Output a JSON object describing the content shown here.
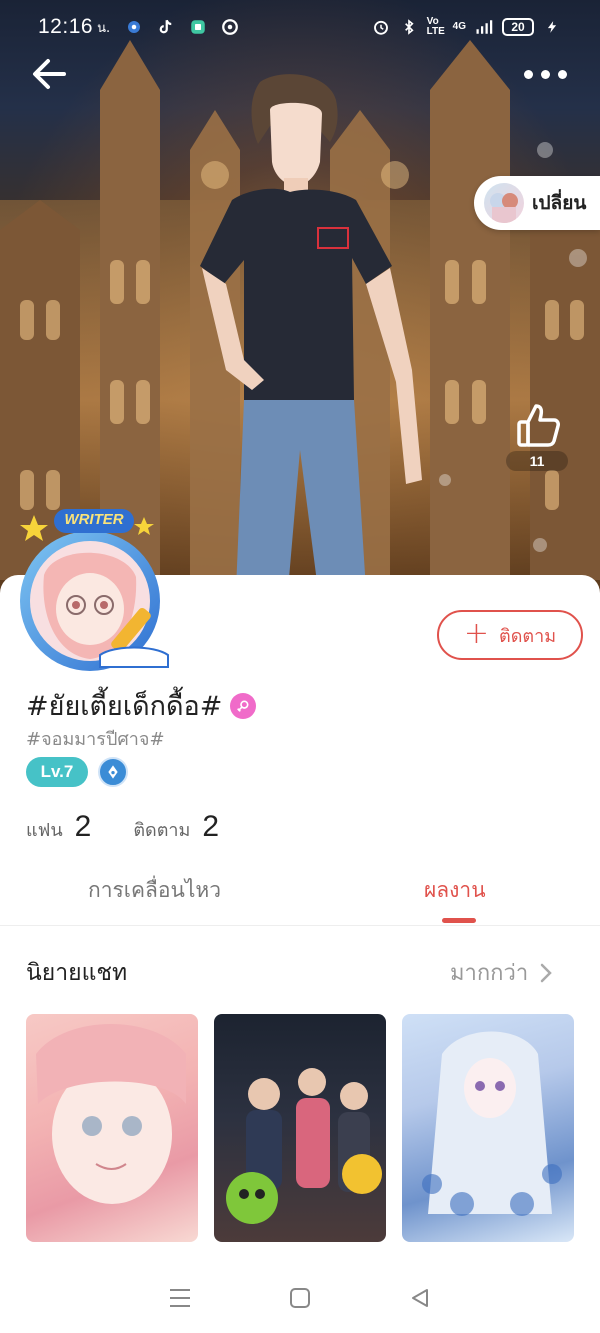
{
  "status_bar": {
    "time": "12:16",
    "carrier_label": "น.",
    "volte_label": "Vo LTE",
    "network_label": "4G",
    "battery_level": "20"
  },
  "header": {
    "change_label": "เปลี่ยน",
    "like_count": "11"
  },
  "profile": {
    "badge_banner": "WRITER",
    "name": "#ยัยเตี้ยเด็กดื้อ#",
    "tag": "#จอมมารปีศาจ#",
    "level": "Lv.7",
    "follow_label": "ติดตาม"
  },
  "stats": {
    "fans_label": "แฟน",
    "fans_value": "2",
    "following_label": "ติดตาม",
    "following_value": "2"
  },
  "tabs": {
    "activity_label": "การเคลื่อนไหว",
    "works_label": "ผลงาน",
    "active": "works"
  },
  "section": {
    "title": "นิยายแชท",
    "more_label": "มากกว่า"
  },
  "icons": {
    "back": "arrow-left-icon",
    "more": "more-dots-icon",
    "like": "thumbs-up-icon",
    "follow_plus": "plus-icon",
    "gender": "female-icon",
    "writer": "pen-nib-icon",
    "chevron": "chevron-right-icon"
  },
  "colors": {
    "accent": "#e0524c",
    "level": "#46c2c7",
    "gender": "#f06bc9"
  }
}
